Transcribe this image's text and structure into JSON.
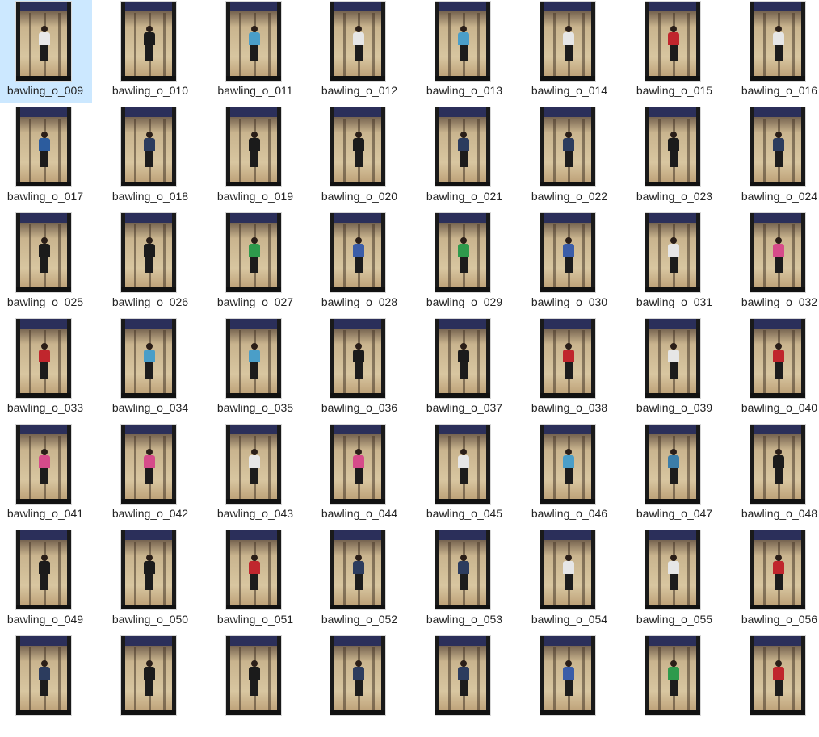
{
  "files": [
    {
      "name": "bawling_o_009",
      "selected": true,
      "shirt": "#e8e8e8"
    },
    {
      "name": "bawling_o_010",
      "shirt": "#1b1b1b"
    },
    {
      "name": "bawling_o_011",
      "shirt": "#4a9ec8"
    },
    {
      "name": "bawling_o_012",
      "shirt": "#e6e6e6"
    },
    {
      "name": "bawling_o_013",
      "shirt": "#4a9ec8"
    },
    {
      "name": "bawling_o_014",
      "shirt": "#e6e6e6"
    },
    {
      "name": "bawling_o_015",
      "shirt": "#c0262d"
    },
    {
      "name": "bawling_o_016",
      "shirt": "#e6e6e6"
    },
    {
      "name": "bawling_o_017",
      "shirt": "#2c5c9e"
    },
    {
      "name": "bawling_o_018",
      "shirt": "#2c3c5e"
    },
    {
      "name": "bawling_o_019",
      "shirt": "#1b1b1b"
    },
    {
      "name": "bawling_o_020",
      "shirt": "#1b1b1b"
    },
    {
      "name": "bawling_o_021",
      "shirt": "#2c3c5e"
    },
    {
      "name": "bawling_o_022",
      "shirt": "#2c3c5e"
    },
    {
      "name": "bawling_o_023",
      "shirt": "#1b1b1b"
    },
    {
      "name": "bawling_o_024",
      "shirt": "#2c3c5e"
    },
    {
      "name": "bawling_o_025",
      "shirt": "#1b1b1b"
    },
    {
      "name": "bawling_o_026",
      "shirt": "#1b1b1b"
    },
    {
      "name": "bawling_o_027",
      "shirt": "#2e9a4c"
    },
    {
      "name": "bawling_o_028",
      "shirt": "#3b5da8"
    },
    {
      "name": "bawling_o_029",
      "shirt": "#2e9a4c"
    },
    {
      "name": "bawling_o_030",
      "shirt": "#3b5da8"
    },
    {
      "name": "bawling_o_031",
      "shirt": "#e6e6e6"
    },
    {
      "name": "bawling_o_032",
      "shirt": "#d64b8a"
    },
    {
      "name": "bawling_o_033",
      "shirt": "#c0262d"
    },
    {
      "name": "bawling_o_034",
      "shirt": "#4a9ec8"
    },
    {
      "name": "bawling_o_035",
      "shirt": "#4a9ec8"
    },
    {
      "name": "bawling_o_036",
      "shirt": "#1b1b1b"
    },
    {
      "name": "bawling_o_037",
      "shirt": "#1b1b1b"
    },
    {
      "name": "bawling_o_038",
      "shirt": "#c0262d"
    },
    {
      "name": "bawling_o_039",
      "shirt": "#e6e6e6"
    },
    {
      "name": "bawling_o_040",
      "shirt": "#c0262d"
    },
    {
      "name": "bawling_o_041",
      "shirt": "#d64b8a"
    },
    {
      "name": "bawling_o_042",
      "shirt": "#d64b8a"
    },
    {
      "name": "bawling_o_043",
      "shirt": "#e6e6e6"
    },
    {
      "name": "bawling_o_044",
      "shirt": "#d64b8a"
    },
    {
      "name": "bawling_o_045",
      "shirt": "#e6e6e6"
    },
    {
      "name": "bawling_o_046",
      "shirt": "#4a9ec8"
    },
    {
      "name": "bawling_o_047",
      "shirt": "#3b7da8"
    },
    {
      "name": "bawling_o_048",
      "shirt": "#1b1b1b"
    },
    {
      "name": "bawling_o_049",
      "shirt": "#1b1b1b"
    },
    {
      "name": "bawling_o_050",
      "shirt": "#1b1b1b"
    },
    {
      "name": "bawling_o_051",
      "shirt": "#c0262d"
    },
    {
      "name": "bawling_o_052",
      "shirt": "#2c3c5e"
    },
    {
      "name": "bawling_o_053",
      "shirt": "#2c3c5e"
    },
    {
      "name": "bawling_o_054",
      "shirt": "#e6e6e6"
    },
    {
      "name": "bawling_o_055",
      "shirt": "#e6e6e6"
    },
    {
      "name": "bawling_o_056",
      "shirt": "#c0262d"
    },
    {
      "name": "",
      "shirt": "#2c3c5e"
    },
    {
      "name": "",
      "shirt": "#1b1b1b"
    },
    {
      "name": "",
      "shirt": "#1b1b1b"
    },
    {
      "name": "",
      "shirt": "#2c3c5e"
    },
    {
      "name": "",
      "shirt": "#2c3c5e"
    },
    {
      "name": "",
      "shirt": "#3b5da8"
    },
    {
      "name": "",
      "shirt": "#2e9a4c"
    },
    {
      "name": "",
      "shirt": "#c0262d"
    }
  ],
  "selection_color": "#cce8ff"
}
